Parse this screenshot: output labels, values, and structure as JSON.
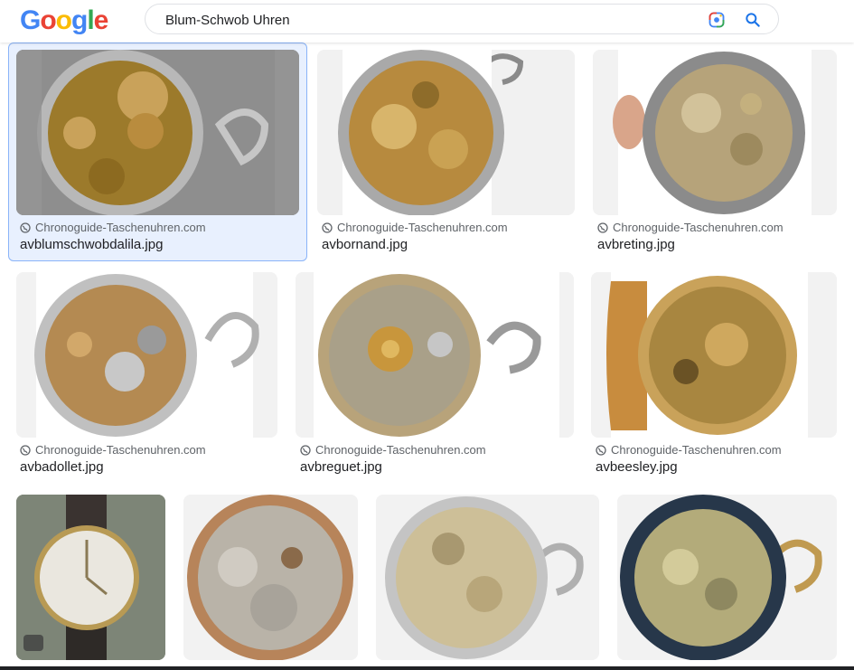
{
  "logo": {
    "letters": [
      "G",
      "o",
      "o",
      "g",
      "l",
      "e"
    ],
    "colors": [
      "#4285F4",
      "#EA4335",
      "#FBBC05",
      "#4285F4",
      "#34A853",
      "#EA4335"
    ]
  },
  "search": {
    "query": "Blum-Schwob Uhren"
  },
  "results": [
    {
      "source": "Chronoguide-Taschenuhren.com",
      "filename": "avblumschwobdalila.jpg",
      "selected": true
    },
    {
      "source": "Chronoguide-Taschenuhren.com",
      "filename": "avbornand.jpg"
    },
    {
      "source": "Chronoguide-Taschenuhren.com",
      "filename": "avbreting.jpg"
    },
    {
      "source": "Chronoguide-Taschenuhren.com",
      "filename": "avbadollet.jpg"
    },
    {
      "source": "Chronoguide-Taschenuhren.com",
      "filename": "avbreguet.jpg"
    },
    {
      "source": "Chronoguide-Taschenuhren.com",
      "filename": "avbeesley.jpg"
    }
  ],
  "row3": [
    {
      "kind": "wristwatch",
      "badge": "tag-icon"
    },
    {
      "kind": "movement"
    },
    {
      "kind": "movement"
    },
    {
      "kind": "movement"
    }
  ],
  "colors": {
    "accent": "#1a73e8",
    "selected_bg": "#e8f0fe"
  }
}
